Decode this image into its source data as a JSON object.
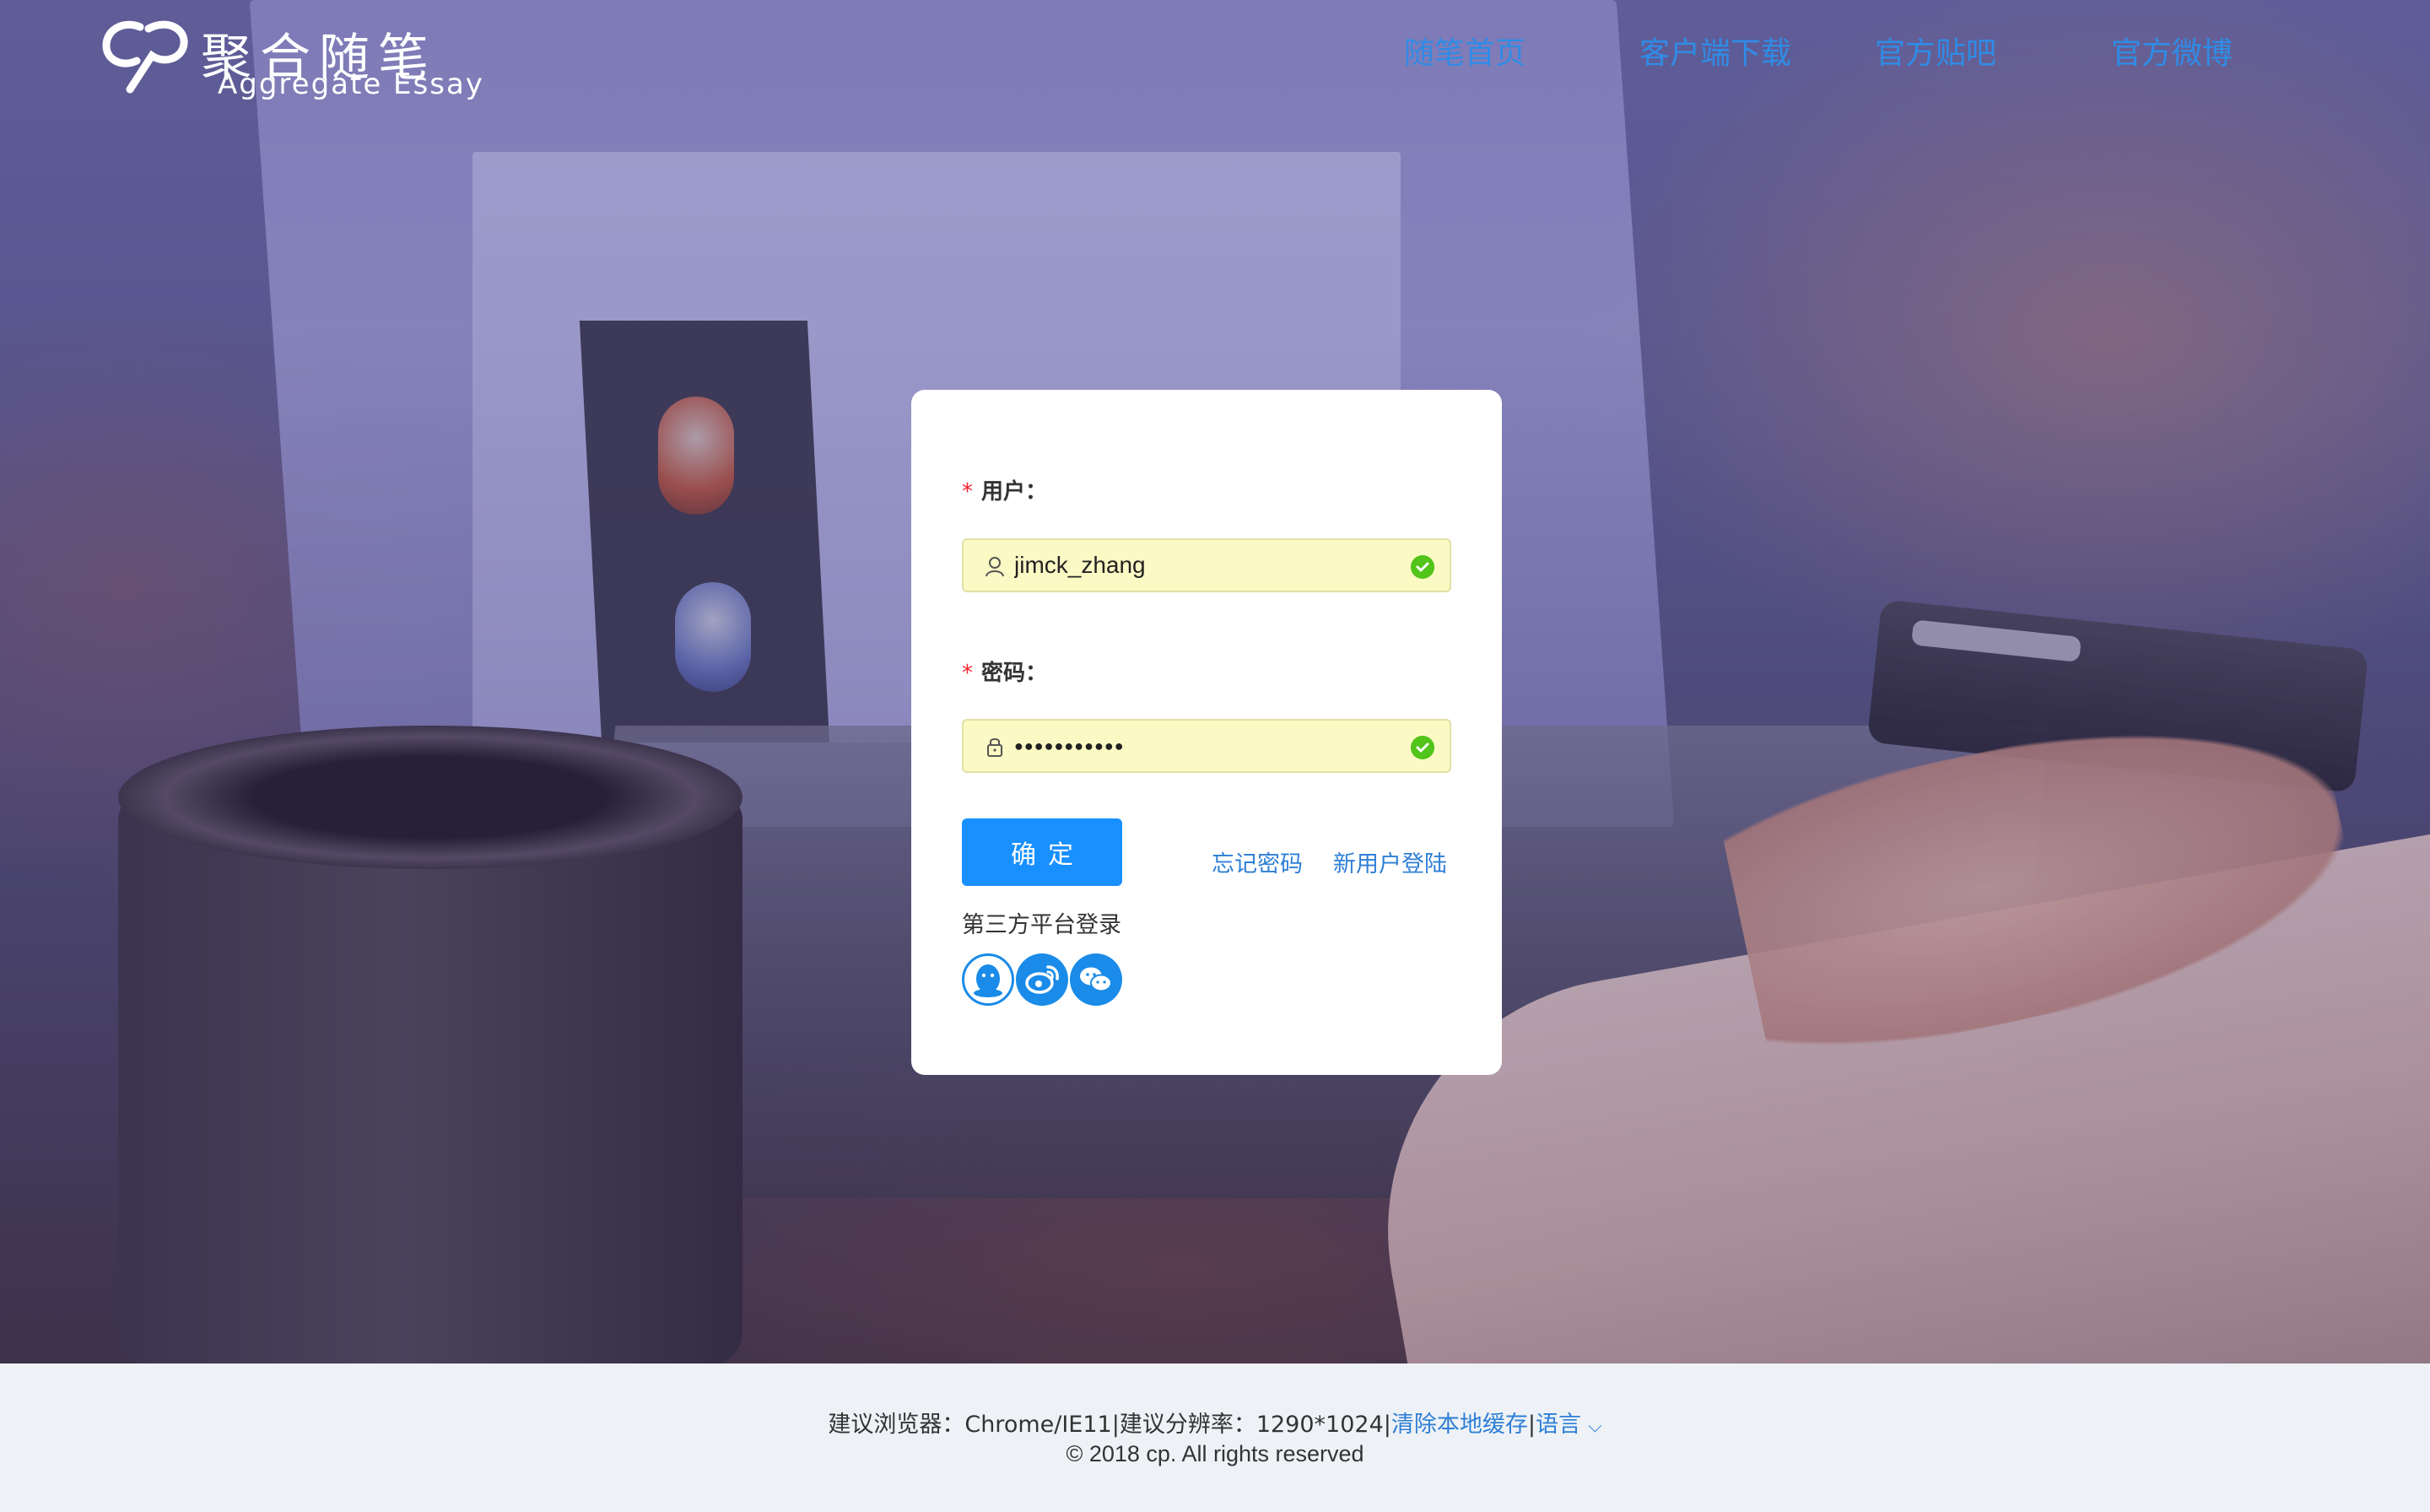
{
  "header": {
    "logo_cn": "聚合随笔",
    "logo_en": "Aggregate Essay",
    "nav": [
      {
        "label": "随笔首页"
      },
      {
        "label": "客户端下载"
      },
      {
        "label": "官方贴吧"
      },
      {
        "label": "官方微博"
      }
    ]
  },
  "login": {
    "user_label": "用户：",
    "username_value": "jimck_zhang",
    "password_label": "密码：",
    "password_value": "●●●●●●●●●●●",
    "required_mark": "*",
    "submit_label": "确定",
    "forgot_label": "忘记密码",
    "register_label": "新用户登陆",
    "third_party_label": "第三方平台登录",
    "third_party": [
      "qq-icon",
      "weibo-icon",
      "wechat-icon"
    ]
  },
  "footer": {
    "browser_text": "建议浏览器：Chrome/IE11|建议分辨率：1290*1024|",
    "clear_cache": "清除本地缓存",
    "separator": "|",
    "language": "语言",
    "copyright": "© 2018 cp. All rights reserved"
  },
  "colors": {
    "accent": "#1890ff",
    "link": "#2f7fd6",
    "nav": "#2f8ce6",
    "required": "#f5222d",
    "valid": "#52c41a",
    "autofill": "#fbf9c4"
  }
}
